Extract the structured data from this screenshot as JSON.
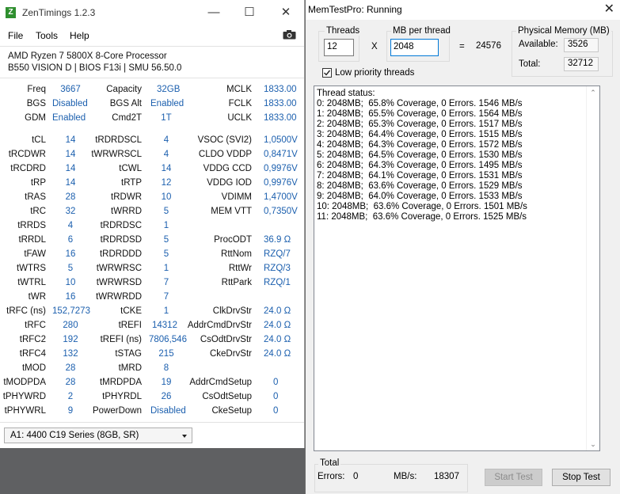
{
  "zen": {
    "title": "ZenTimings 1.2.3",
    "icon": "Z",
    "menu": [
      "File",
      "Tools",
      "Help"
    ],
    "cpu": "AMD Ryzen 7 5800X 8-Core Processor",
    "board": "B550 VISION D | BIOS F13i | SMU 56.50.0",
    "rows": [
      [
        [
          "Freq",
          "3667"
        ],
        [
          "Capacity",
          "32GB"
        ],
        [
          "MCLK",
          "1833.00"
        ]
      ],
      [
        [
          "BGS",
          "Disabled"
        ],
        [
          "BGS Alt",
          "Enabled"
        ],
        [
          "FCLK",
          "1833.00"
        ]
      ],
      [
        [
          "GDM",
          "Enabled"
        ],
        [
          "Cmd2T",
          "1T"
        ],
        [
          "UCLK",
          "1833.00"
        ]
      ],
      [
        [
          "tCL",
          "14"
        ],
        [
          "tRDRDSCL",
          "4"
        ],
        [
          "VSOC (SVI2)",
          "1,0500V"
        ]
      ],
      [
        [
          "tRCDWR",
          "14"
        ],
        [
          "tWRWRSCL",
          "4"
        ],
        [
          "CLDO VDDP",
          "0,8471V"
        ]
      ],
      [
        [
          "tRCDRD",
          "14"
        ],
        [
          "tCWL",
          "14"
        ],
        [
          "VDDG CCD",
          "0,9976V"
        ]
      ],
      [
        [
          "tRP",
          "14"
        ],
        [
          "tRTP",
          "12"
        ],
        [
          "VDDG IOD",
          "0,9976V"
        ]
      ],
      [
        [
          "tRAS",
          "28"
        ],
        [
          "tRDWR",
          "10"
        ],
        [
          "VDIMM",
          "1,4700V"
        ]
      ],
      [
        [
          "tRC",
          "32"
        ],
        [
          "tWRRD",
          "5"
        ],
        [
          "MEM VTT",
          "0,7350V"
        ]
      ],
      [
        [
          "tRRDS",
          "4"
        ],
        [
          "tRDRDSC",
          "1"
        ],
        [
          "",
          ""
        ]
      ],
      [
        [
          "tRRDL",
          "6"
        ],
        [
          "tRDRDSD",
          "5"
        ],
        [
          "ProcODT",
          "36.9 Ω"
        ]
      ],
      [
        [
          "tFAW",
          "16"
        ],
        [
          "tRDRDDD",
          "5"
        ],
        [
          "RttNom",
          "RZQ/7"
        ]
      ],
      [
        [
          "tWTRS",
          "5"
        ],
        [
          "tWRWRSC",
          "1"
        ],
        [
          "RttWr",
          "RZQ/3"
        ]
      ],
      [
        [
          "tWTRL",
          "10"
        ],
        [
          "tWRWRSD",
          "7"
        ],
        [
          "RttPark",
          "RZQ/1"
        ]
      ],
      [
        [
          "tWR",
          "16"
        ],
        [
          "tWRWRDD",
          "7"
        ],
        [
          "",
          ""
        ]
      ],
      [
        [
          "tRFC (ns)",
          "152,7273"
        ],
        [
          "tCKE",
          "1"
        ],
        [
          "ClkDrvStr",
          "24.0 Ω"
        ]
      ],
      [
        [
          "tRFC",
          "280"
        ],
        [
          "tREFI",
          "14312"
        ],
        [
          "AddrCmdDrvStr",
          "24.0 Ω"
        ]
      ],
      [
        [
          "tRFC2",
          "192"
        ],
        [
          "tREFI (ns)",
          "7806,546"
        ],
        [
          "CsOdtDrvStr",
          "24.0 Ω"
        ]
      ],
      [
        [
          "tRFC4",
          "132"
        ],
        [
          "tSTAG",
          "215"
        ],
        [
          "CkeDrvStr",
          "24.0 Ω"
        ]
      ],
      [
        [
          "tMOD",
          "28"
        ],
        [
          "tMRD",
          "8"
        ],
        [
          "",
          ""
        ]
      ],
      [
        [
          "tMODPDA",
          "28"
        ],
        [
          "tMRDPDA",
          "19"
        ],
        [
          "AddrCmdSetup",
          "0"
        ]
      ],
      [
        [
          "tPHYWRD",
          "2"
        ],
        [
          "tPHYRDL",
          "26"
        ],
        [
          "CsOdtSetup",
          "0"
        ]
      ],
      [
        [
          "tPHYWRL",
          "9"
        ],
        [
          "PowerDown",
          "Disabled"
        ],
        [
          "CkeSetup",
          "0"
        ]
      ]
    ],
    "dimm_selected": "A1: 4400 C19 Series (8GB, SR)",
    "value_color": "#1b5fae"
  },
  "mtp": {
    "title": "MemTestPro: Running",
    "threads_label": "Threads",
    "threads_value": "12",
    "times": "X",
    "mb_label": "MB per thread",
    "mb_value": "2048",
    "equals": "=",
    "total_mb": "24576",
    "phys_label": "Physical Memory (MB)",
    "available_label": "Available:",
    "available_value": "3526",
    "total_label": "Total:",
    "total_value": "32712",
    "low_priority_label": "Low priority threads",
    "low_priority_checked": true,
    "status_lines": [
      "Thread status:",
      "0: 2048MB;  65.8% Coverage, 0 Errors. 1546 MB/s",
      "1: 2048MB;  65.5% Coverage, 0 Errors. 1564 MB/s",
      "2: 2048MB;  65.3% Coverage, 0 Errors. 1517 MB/s",
      "3: 2048MB;  64.4% Coverage, 0 Errors. 1515 MB/s",
      "4: 2048MB;  64.3% Coverage, 0 Errors. 1572 MB/s",
      "5: 2048MB;  64.5% Coverage, 0 Errors. 1530 MB/s",
      "6: 2048MB;  64.3% Coverage, 0 Errors. 1495 MB/s",
      "7: 2048MB;  64.1% Coverage, 0 Errors. 1531 MB/s",
      "8: 2048MB;  63.6% Coverage, 0 Errors. 1529 MB/s",
      "9: 2048MB;  64.0% Coverage, 0 Errors. 1533 MB/s",
      "10: 2048MB;  63.6% Coverage, 0 Errors. 1501 MB/s",
      "11: 2048MB;  63.6% Coverage, 0 Errors. 1525 MB/s"
    ],
    "total_group": "Total",
    "errors_label": "Errors:",
    "errors_value": "0",
    "mbs_label": "MB/s:",
    "mbs_value": "18307",
    "start_button": "Start Test",
    "stop_button": "Stop Test"
  }
}
